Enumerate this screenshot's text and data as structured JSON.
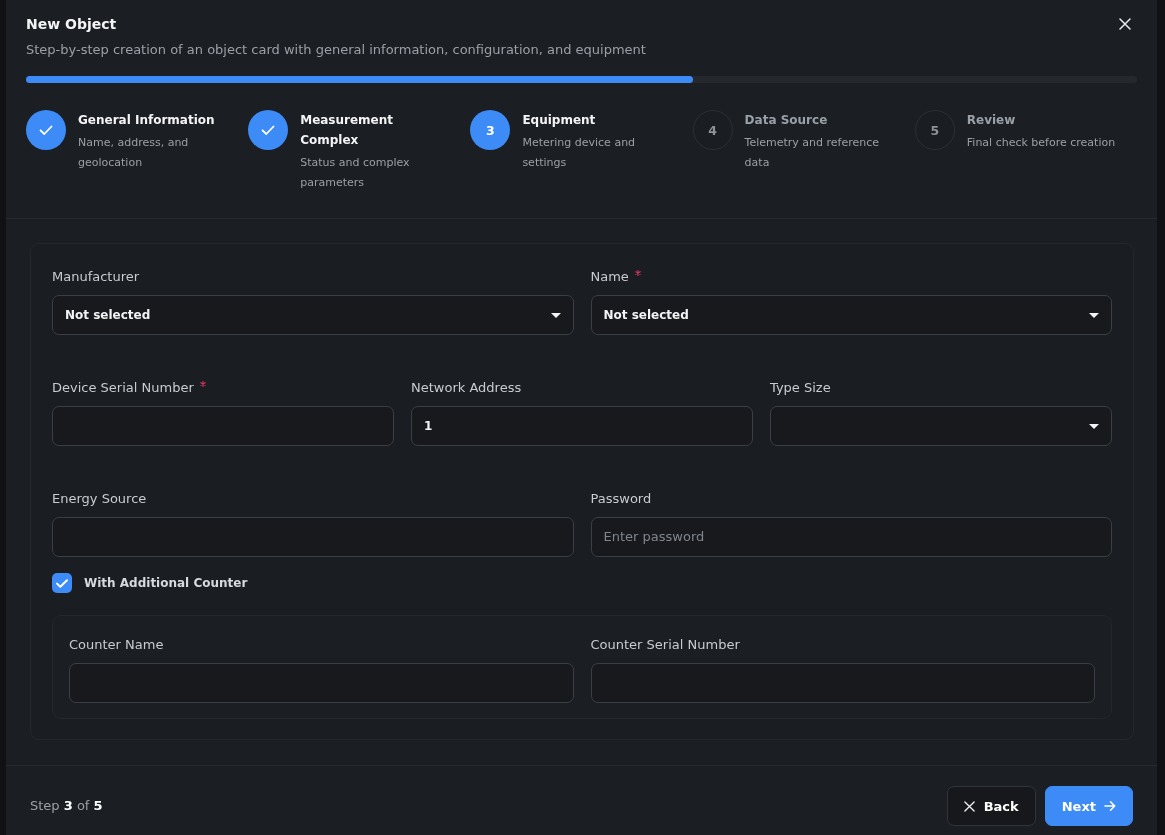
{
  "dialog": {
    "title": "New Object",
    "subtitle": "Step-by-step creation of an object card with general information, configuration, and equipment"
  },
  "progress": {
    "level": 0.6
  },
  "steps": [
    {
      "title": "General Information",
      "description": "Name, address, and geolocation",
      "completed": true,
      "selected": false
    },
    {
      "title": "Measurement Complex",
      "description": "Status and complex parameters",
      "completed": true,
      "selected": false
    },
    {
      "number": "3",
      "title": "Equipment",
      "description": "Metering device and settings",
      "completed": false,
      "selected": true
    },
    {
      "number": "4",
      "title": "Data Source",
      "description": "Telemetry and reference data",
      "completed": false,
      "selected": false
    },
    {
      "number": "5",
      "title": "Review",
      "description": "Final check before creation",
      "completed": false,
      "selected": false
    }
  ],
  "form": {
    "rows": [
      {
        "fields": [
          {
            "label": "Manufacturer",
            "required": false,
            "kind": "select",
            "value": "Not selected"
          },
          {
            "label": "Name",
            "required": true,
            "kind": "select",
            "value": "Not selected"
          }
        ]
      },
      {
        "fields": [
          {
            "label": "Device Serial Number",
            "required": true,
            "kind": "text"
          },
          {
            "label": "Network Address",
            "required": false,
            "kind": "text",
            "value": "1"
          },
          {
            "label": "Type Size",
            "required": false,
            "kind": "select"
          }
        ]
      },
      {
        "fields": [
          {
            "label": "Energy Source",
            "required": false,
            "kind": "text"
          },
          {
            "label": "Password",
            "required": false,
            "kind": "password",
            "placeholder": "Enter password"
          }
        ]
      }
    ],
    "additional_counter": {
      "label": "With Additional Counter",
      "checked": true,
      "fields": [
        {
          "label": "Counter Name",
          "required": false,
          "kind": "text"
        },
        {
          "label": "Counter Serial Number",
          "required": false,
          "kind": "text"
        }
      ]
    }
  },
  "footer": {
    "step_text": "Step **3** of **5**",
    "buttons": [
      {
        "label": "Back",
        "kind": "secondary"
      },
      {
        "label": "Next",
        "kind": "primary"
      }
    ]
  }
}
